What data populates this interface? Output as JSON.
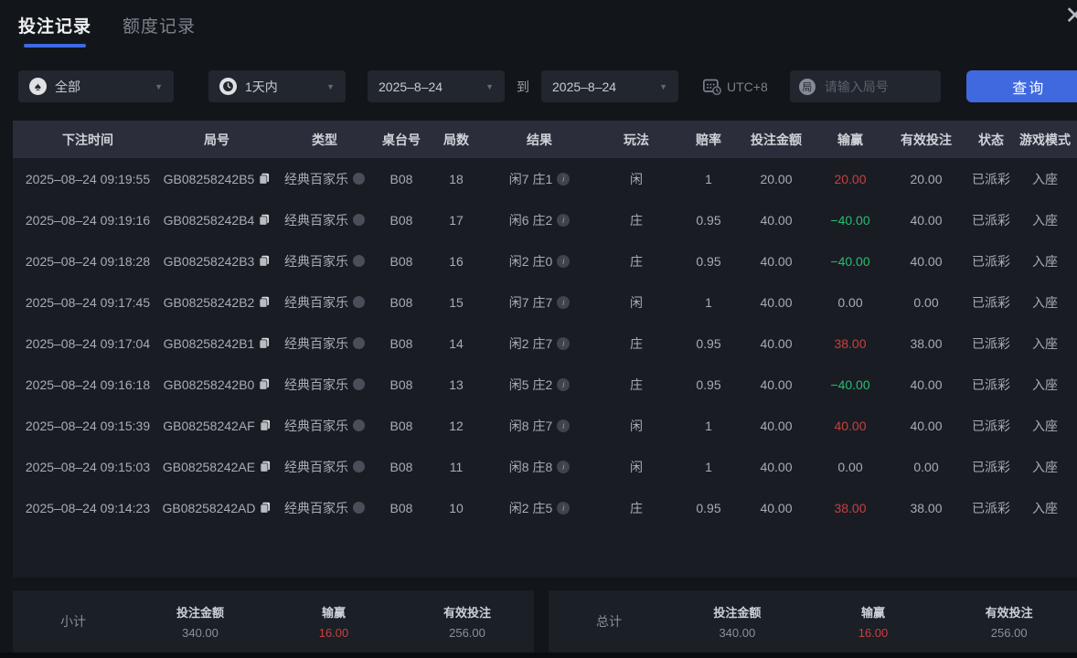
{
  "colors": {
    "accent_blue": "#4169df",
    "tab_underline": "#3d6be4",
    "win_red": "#c84040",
    "loss_green": "#28bd71",
    "header_bg": "#2b2e3a",
    "page_bg": "#12151a"
  },
  "icons": {
    "close": "close-icon",
    "game_type_filter": "spade-icon",
    "time_filter": "clock-icon",
    "timezone": "calendar-clock-icon",
    "search_prefix_glyph": "局",
    "copy": "copy-icon",
    "type_badge": "circle-badge-icon",
    "result_info": "info-icon",
    "caret_glyph": "▼"
  },
  "window": {
    "close_glyph": "✕"
  },
  "tabs": [
    {
      "label": "投注记录",
      "active": true
    },
    {
      "label": "额度记录",
      "active": false
    }
  ],
  "filters": {
    "game_type": {
      "value": "全部",
      "spade_glyph": "♠"
    },
    "time_range": {
      "value": "1天内"
    },
    "date_from": {
      "value": "2025–8–24"
    },
    "to_label": "到",
    "date_to": {
      "value": "2025–8–24"
    },
    "timezone_label": "UTC+8",
    "search": {
      "placeholder": "请输入局号",
      "prefix_glyph": "局"
    },
    "query_button_label": "查询"
  },
  "table": {
    "headers": [
      "下注时间",
      "局号",
      "类型",
      "桌台号",
      "局数",
      "结果",
      "玩法",
      "赔率",
      "投注金额",
      "输赢",
      "有效投注",
      "状态",
      "游戏模式"
    ],
    "rows": [
      {
        "time": "2025–08–24 09:19:55",
        "game_id": "GB08258242B5",
        "type": "经典百家乐",
        "table_no": "B08",
        "round": "18",
        "result": "闲7 庄1",
        "play": "闲",
        "odds": "1",
        "bet_amount": "20.00",
        "win_loss": "20.00",
        "win_loss_color": "red",
        "valid_bet": "20.00",
        "status": "已派彩",
        "mode": "入座"
      },
      {
        "time": "2025–08–24 09:19:16",
        "game_id": "GB08258242B4",
        "type": "经典百家乐",
        "table_no": "B08",
        "round": "17",
        "result": "闲6 庄2",
        "play": "庄",
        "odds": "0.95",
        "bet_amount": "40.00",
        "win_loss": "−40.00",
        "win_loss_color": "green",
        "valid_bet": "40.00",
        "status": "已派彩",
        "mode": "入座"
      },
      {
        "time": "2025–08–24 09:18:28",
        "game_id": "GB08258242B3",
        "type": "经典百家乐",
        "table_no": "B08",
        "round": "16",
        "result": "闲2 庄0",
        "play": "庄",
        "odds": "0.95",
        "bet_amount": "40.00",
        "win_loss": "−40.00",
        "win_loss_color": "green",
        "valid_bet": "40.00",
        "status": "已派彩",
        "mode": "入座"
      },
      {
        "time": "2025–08–24 09:17:45",
        "game_id": "GB08258242B2",
        "type": "经典百家乐",
        "table_no": "B08",
        "round": "15",
        "result": "闲7 庄7",
        "play": "闲",
        "odds": "1",
        "bet_amount": "40.00",
        "win_loss": "0.00",
        "win_loss_color": "none",
        "valid_bet": "0.00",
        "status": "已派彩",
        "mode": "入座"
      },
      {
        "time": "2025–08–24 09:17:04",
        "game_id": "GB08258242B1",
        "type": "经典百家乐",
        "table_no": "B08",
        "round": "14",
        "result": "闲2 庄7",
        "play": "庄",
        "odds": "0.95",
        "bet_amount": "40.00",
        "win_loss": "38.00",
        "win_loss_color": "red",
        "valid_bet": "38.00",
        "status": "已派彩",
        "mode": "入座"
      },
      {
        "time": "2025–08–24 09:16:18",
        "game_id": "GB08258242B0",
        "type": "经典百家乐",
        "table_no": "B08",
        "round": "13",
        "result": "闲5 庄2",
        "play": "庄",
        "odds": "0.95",
        "bet_amount": "40.00",
        "win_loss": "−40.00",
        "win_loss_color": "green",
        "valid_bet": "40.00",
        "status": "已派彩",
        "mode": "入座"
      },
      {
        "time": "2025–08–24 09:15:39",
        "game_id": "GB08258242AF",
        "type": "经典百家乐",
        "table_no": "B08",
        "round": "12",
        "result": "闲8 庄7",
        "play": "闲",
        "odds": "1",
        "bet_amount": "40.00",
        "win_loss": "40.00",
        "win_loss_color": "red",
        "valid_bet": "40.00",
        "status": "已派彩",
        "mode": "入座"
      },
      {
        "time": "2025–08–24 09:15:03",
        "game_id": "GB08258242AE",
        "type": "经典百家乐",
        "table_no": "B08",
        "round": "11",
        "result": "闲8 庄8",
        "play": "闲",
        "odds": "1",
        "bet_amount": "40.00",
        "win_loss": "0.00",
        "win_loss_color": "none",
        "valid_bet": "0.00",
        "status": "已派彩",
        "mode": "入座"
      },
      {
        "time": "2025–08–24 09:14:23",
        "game_id": "GB08258242AD",
        "type": "经典百家乐",
        "table_no": "B08",
        "round": "10",
        "result": "闲2 庄5",
        "play": "庄",
        "odds": "0.95",
        "bet_amount": "40.00",
        "win_loss": "38.00",
        "win_loss_color": "red",
        "valid_bet": "38.00",
        "status": "已派彩",
        "mode": "入座"
      }
    ]
  },
  "summary": {
    "subtotal": {
      "title": "小计",
      "bet_amount_label": "投注金额",
      "bet_amount": "340.00",
      "win_loss_label": "输赢",
      "win_loss": "16.00",
      "valid_bet_label": "有效投注",
      "valid_bet": "256.00"
    },
    "total": {
      "title": "总计",
      "bet_amount_label": "投注金额",
      "bet_amount": "340.00",
      "win_loss_label": "输赢",
      "win_loss": "16.00",
      "valid_bet_label": "有效投注",
      "valid_bet": "256.00"
    }
  }
}
